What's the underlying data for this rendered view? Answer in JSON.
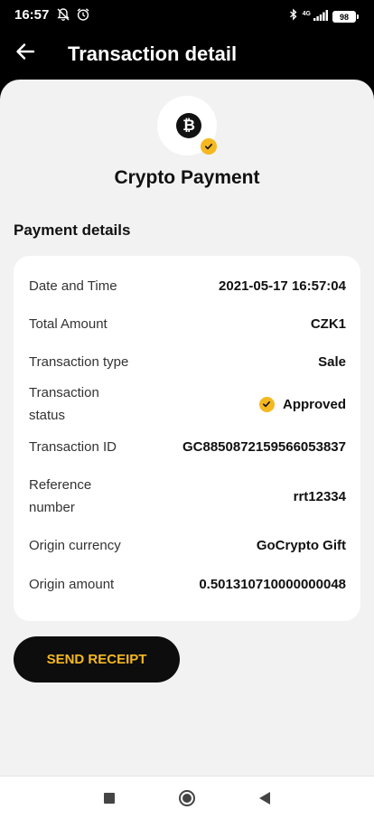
{
  "status_bar": {
    "time": "16:57",
    "network": "4G",
    "battery": "98",
    "icons": [
      "mute-bell-icon",
      "alarm-icon",
      "bluetooth-icon",
      "signal-icon"
    ]
  },
  "header": {
    "back_icon": "arrow-left-icon",
    "title": "Transaction detail"
  },
  "merchant": {
    "icon": "bitcoin-icon",
    "coin_symbol": "₿",
    "badge_icon": "check-icon",
    "title": "Crypto Payment"
  },
  "details": {
    "section_title": "Payment details",
    "rows": [
      {
        "label": "Date and Time",
        "value": "2021-05-17 16:57:04"
      },
      {
        "label": "Total Amount",
        "value": "CZK1"
      },
      {
        "label": "Transaction type",
        "value": "Sale"
      },
      {
        "label": "Transaction\nstatus",
        "value": "Approved"
      },
      {
        "label": "Transaction ID",
        "value": "GC8850872159566053837"
      },
      {
        "label": "Reference\nnumber",
        "value": "rrt12334"
      },
      {
        "label": "Origin currency",
        "value": "GoCrypto Gift"
      },
      {
        "label": "Origin amount",
        "value": "0.501310710000000048"
      }
    ]
  },
  "actions": {
    "send_receipt": "SEND RECEIPT"
  },
  "nav": {
    "icons": [
      "recents-square-icon",
      "home-circle-icon",
      "back-triangle-icon"
    ]
  },
  "colors": {
    "accent": "#f5b820",
    "header_bg": "#000000",
    "page_bg": "#f2f2f2",
    "card_bg": "#ffffff"
  }
}
